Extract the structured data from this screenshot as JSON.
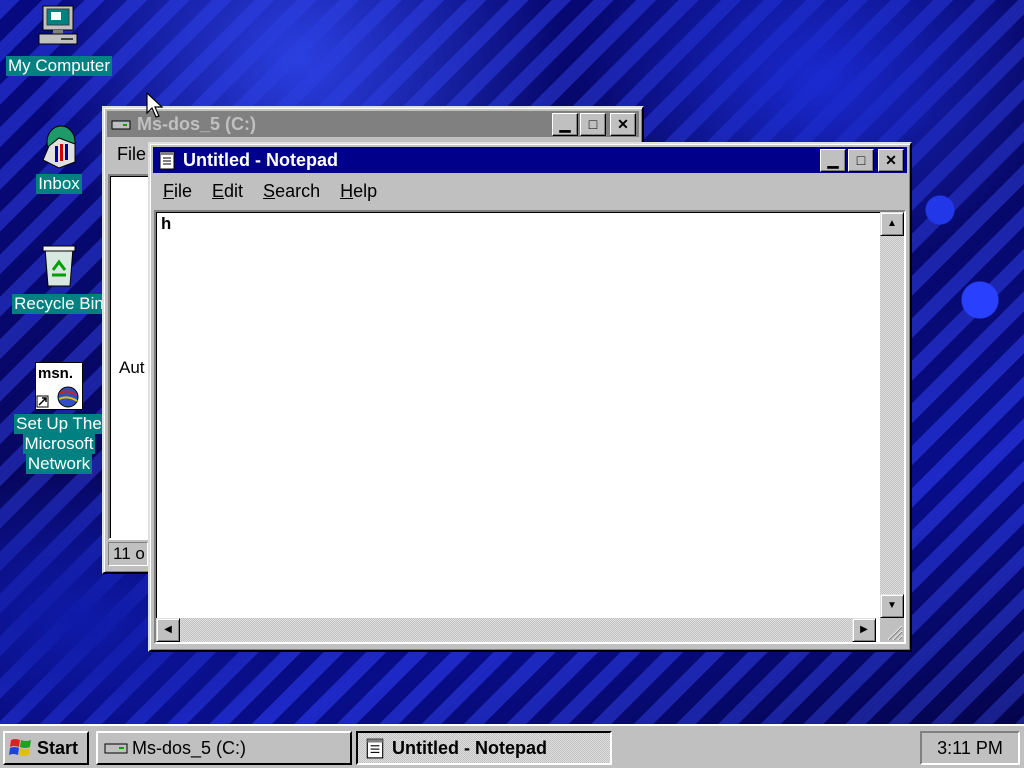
{
  "desktop": {
    "icons": [
      {
        "label": "My Computer",
        "icon": "computer-icon"
      },
      {
        "label": "Inbox",
        "icon": "inbox-icon"
      },
      {
        "label": "Recycle Bin",
        "icon": "recycle-bin-icon"
      },
      {
        "label_lines": [
          "Set Up The",
          "Microsoft",
          "Network"
        ],
        "icon": "msn-icon",
        "badge": "msn."
      }
    ],
    "selection_color": "#008080"
  },
  "explorer_window": {
    "title": "Ms-dos_5 (C:)",
    "menu_first": "File",
    "body_text": "Aut",
    "status_text": "11 o",
    "state": "inactive"
  },
  "notepad_window": {
    "title": "Untitled - Notepad",
    "menu": [
      {
        "label": "File",
        "accel": "F",
        "rest": "ile"
      },
      {
        "label": "Edit",
        "accel": "E",
        "rest": "dit"
      },
      {
        "label": "Search",
        "accel": "S",
        "rest": "earch"
      },
      {
        "label": "Help",
        "accel": "H",
        "rest": "elp"
      }
    ],
    "content": "h",
    "state": "active"
  },
  "taskbar": {
    "start_label": "Start",
    "tasks": [
      {
        "label": "Ms-dos_5 (C:)",
        "pressed": false
      },
      {
        "label": "Untitled - Notepad",
        "pressed": true
      }
    ],
    "clock": "3:11 PM"
  },
  "colors": {
    "active_title": "#00008b",
    "inactive_title": "#808080",
    "face": "#c0c0c0"
  }
}
